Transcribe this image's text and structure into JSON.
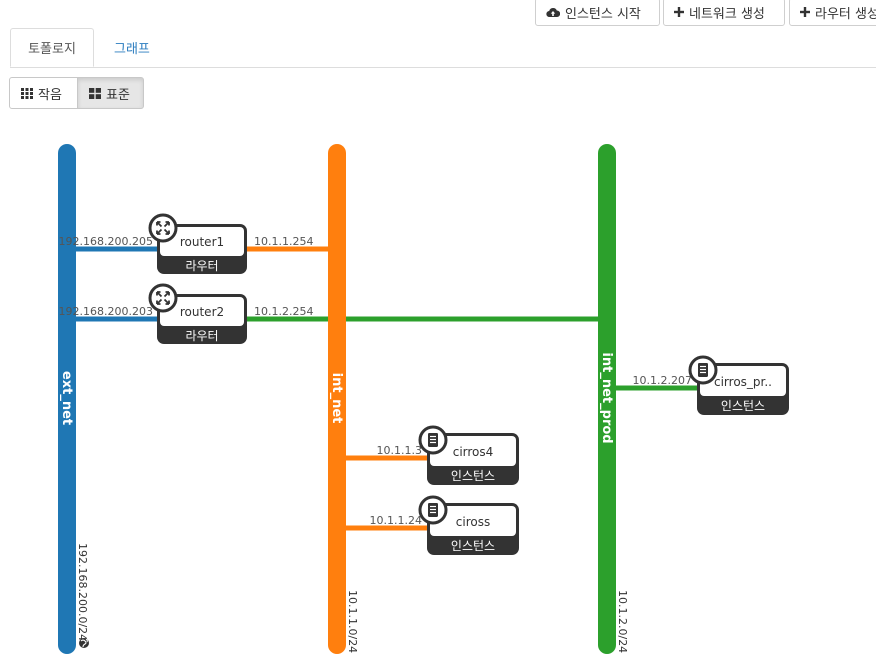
{
  "toolbar": {
    "launch_instance_label": "인스턴스 시작",
    "create_network_label": "네트워크 생성",
    "create_router_label": "라우터 생성"
  },
  "tabs": {
    "topology_label": "토폴로지",
    "graph_label": "그래프"
  },
  "view_toggle": {
    "small_label": "작음",
    "normal_label": "표준"
  },
  "colors": {
    "ext_net": "#1f77b4",
    "int_net": "#ff7f0e",
    "int_net_prod": "#2ca02c",
    "node_border": "#333333"
  },
  "networks": {
    "ext_net": {
      "name": "ext_net",
      "cidr": "192.168.200.0/24"
    },
    "int_net": {
      "name": "int_net",
      "cidr": "10.1.1.0/24"
    },
    "int_net_prod": {
      "name": "int_net_prod",
      "cidr": "10.1.2.0/24"
    }
  },
  "nodes": {
    "router1": {
      "name": "router1",
      "type_label": "라우터",
      "ext_ip": "192.168.200.205",
      "int_ip": "10.1.1.254"
    },
    "router2": {
      "name": "router2",
      "type_label": "라우터",
      "ext_ip": "192.168.200.203",
      "int_ip": "10.1.2.254"
    },
    "cirros_prod": {
      "name": "cirros_pr..",
      "type_label": "인스턴스",
      "ip": "10.1.2.207"
    },
    "cirros4": {
      "name": "cirros4",
      "type_label": "인스턴스",
      "ip": "10.1.1.3"
    },
    "ciross": {
      "name": "ciross",
      "type_label": "인스턴스",
      "ip": "10.1.1.24"
    }
  }
}
